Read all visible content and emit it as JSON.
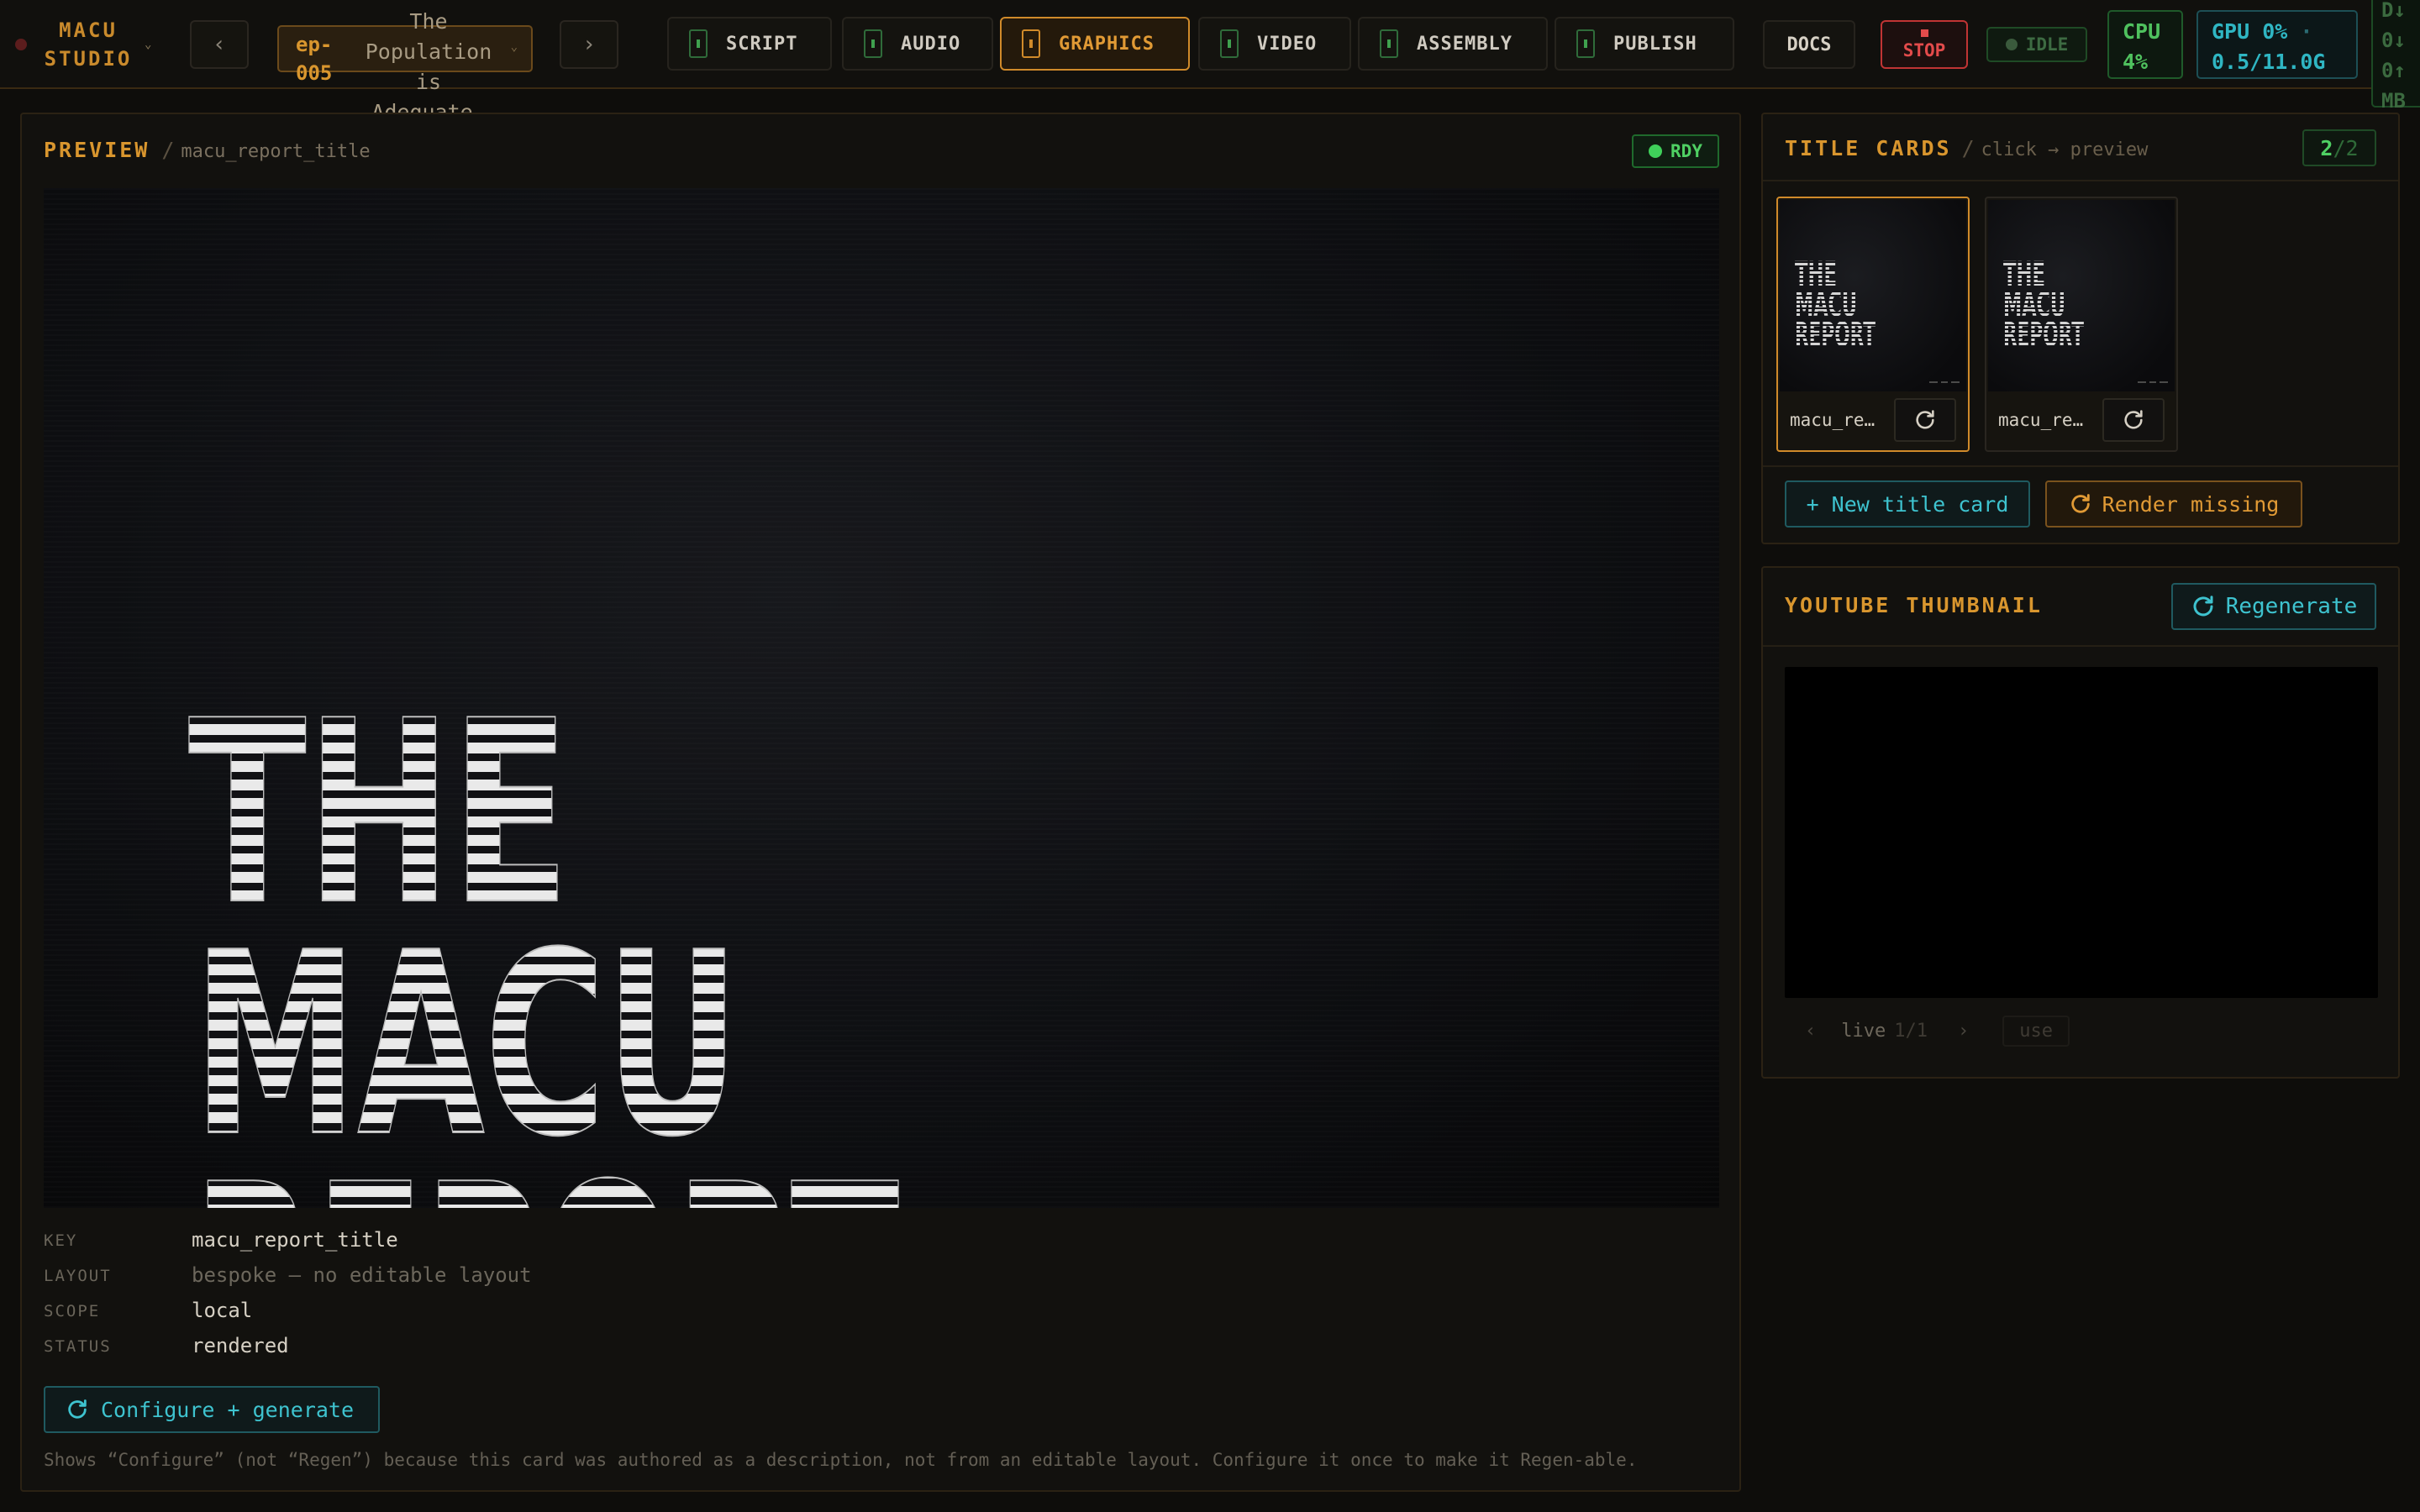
{
  "app": {
    "brand_line1": "MACU",
    "brand_line2": "STUDIO"
  },
  "episode": {
    "id_line1": "ep-",
    "id_line2": "005",
    "title_line1": "The",
    "title_line2": "Population",
    "title_line3": "is",
    "title_line4": "Adequate."
  },
  "tabs": [
    {
      "label": "SCRIPT"
    },
    {
      "label": "AUDIO"
    },
    {
      "label": "GRAPHICS"
    },
    {
      "label": "VIDEO"
    },
    {
      "label": "ASSEMBLY"
    },
    {
      "label": "PUBLISH"
    }
  ],
  "toolbar": {
    "docs": "DOCS",
    "stop": "STOP",
    "idle": "IDLE",
    "cpu_label": "CPU",
    "cpu_value": "4%",
    "gpu_line1": "GPU 0%",
    "gpu_sep": "·",
    "gpu_line2": "0.5/11.0G",
    "net_line1": "D↓",
    "net_line2": "0↓",
    "net_line3": "0↑",
    "net_line4": "MB"
  },
  "preview": {
    "title": "PREVIEW",
    "slash": "/",
    "subtitle": "macu_report_title",
    "status_badge": "RDY",
    "art_line1": "THE",
    "art_line2": "MACU",
    "art_line3": "REPORT",
    "meta": [
      {
        "key": "KEY",
        "value": "macu_report_title"
      },
      {
        "key": "LAYOUT",
        "value": "bespoke — no editable layout"
      },
      {
        "key": "SCOPE",
        "value": "local"
      },
      {
        "key": "STATUS",
        "value": "rendered"
      }
    ],
    "configure_button": "Configure + generate",
    "note": "Shows “Configure” (not “Regen”) because this card was authored as a description, not from an editable layout. Configure it once to make it Regen-able."
  },
  "title_cards": {
    "title": "TITLE CARDS",
    "slash": "/",
    "subtitle": "click → preview",
    "count_current": "2",
    "count_sep": "/",
    "count_total": "2",
    "cards": [
      {
        "name": "macu_re…",
        "selected": true
      },
      {
        "name": "macu_re…",
        "selected": false
      }
    ],
    "new_button": "+ New title card",
    "render_missing_button": "Render missing"
  },
  "thumbnail": {
    "title": "YOUTUBE THUMBNAIL",
    "regenerate_button": "Regenerate",
    "nav_prev": "‹",
    "nav_label": "live",
    "nav_fraction": "1/1",
    "nav_next": "›",
    "use_button": "use"
  },
  "colors": {
    "accent_amber": "#d9962e",
    "accent_cyan": "#3ec3cf",
    "ok_green": "#4fd063",
    "stop_red": "#e24b4b"
  }
}
